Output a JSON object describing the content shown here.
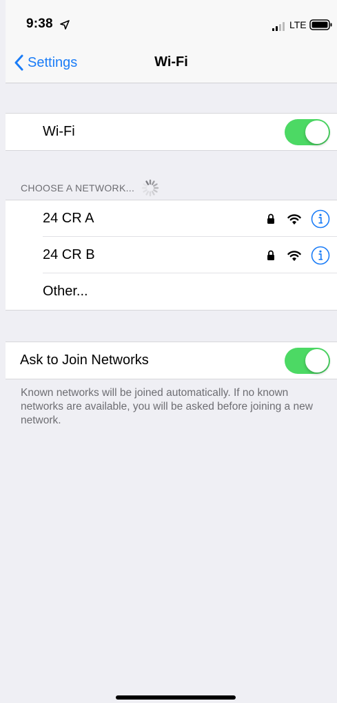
{
  "status_bar": {
    "time": "9:38",
    "carrier": "LTE"
  },
  "nav": {
    "back_label": "Settings",
    "title": "Wi-Fi"
  },
  "wifi": {
    "label": "Wi-Fi",
    "enabled": true
  },
  "networks": {
    "header": "CHOOSE A NETWORK...",
    "items": [
      {
        "name": "24 CR A",
        "secured": true
      },
      {
        "name": "24 CR B",
        "secured": true
      }
    ],
    "other_label": "Other..."
  },
  "ask_to_join": {
    "label": "Ask to Join Networks",
    "enabled": true,
    "footer": "Known networks will be joined automatically. If no known networks are available, you will be asked before joining a new network."
  },
  "colors": {
    "accent": "#1a7cf7",
    "toggle_on": "#4cd964",
    "background": "#efeff4"
  }
}
